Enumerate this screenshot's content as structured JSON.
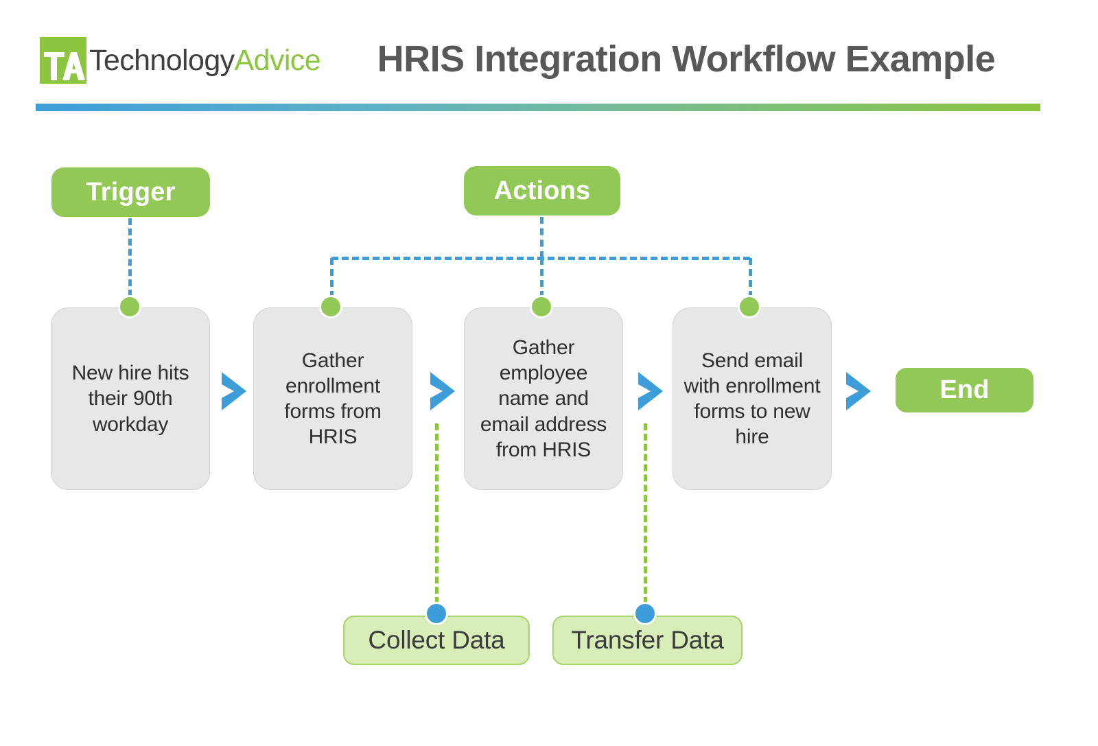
{
  "header": {
    "logo": {
      "mark_text": "TA",
      "word_part1": "Technology",
      "word_part2": "Advice",
      "mark_color": "#8cc63f",
      "word_part1_color": "#3f3f3f",
      "word_part2_color": "#8cc63f"
    },
    "title": "HRIS Integration Workflow Example",
    "title_color": "#58585a",
    "rule_gradient_from": "#3d9dd8",
    "rule_gradient_to": "#8cc63f"
  },
  "colors": {
    "green": "#92c855",
    "green_light": "#d9edb8",
    "green_border": "#a5d26a",
    "blue": "#3d9dd8",
    "box_fill": "#e6e7e7",
    "box_border": "#d2d3d3",
    "text_dark": "#2f2f2f"
  },
  "diagram": {
    "trigger_label": "Trigger",
    "actions_label": "Actions",
    "end_label": "End",
    "nodes": [
      {
        "label": "New hire hits their 90th workday"
      },
      {
        "label": "Gather enrollment forms from HRIS"
      },
      {
        "label": "Gather employee name and email address from HRIS"
      },
      {
        "label": "Send email with enrollment forms to new hire"
      }
    ],
    "data_badges": [
      {
        "label": "Collect Data"
      },
      {
        "label": "Transfer Data"
      }
    ]
  }
}
